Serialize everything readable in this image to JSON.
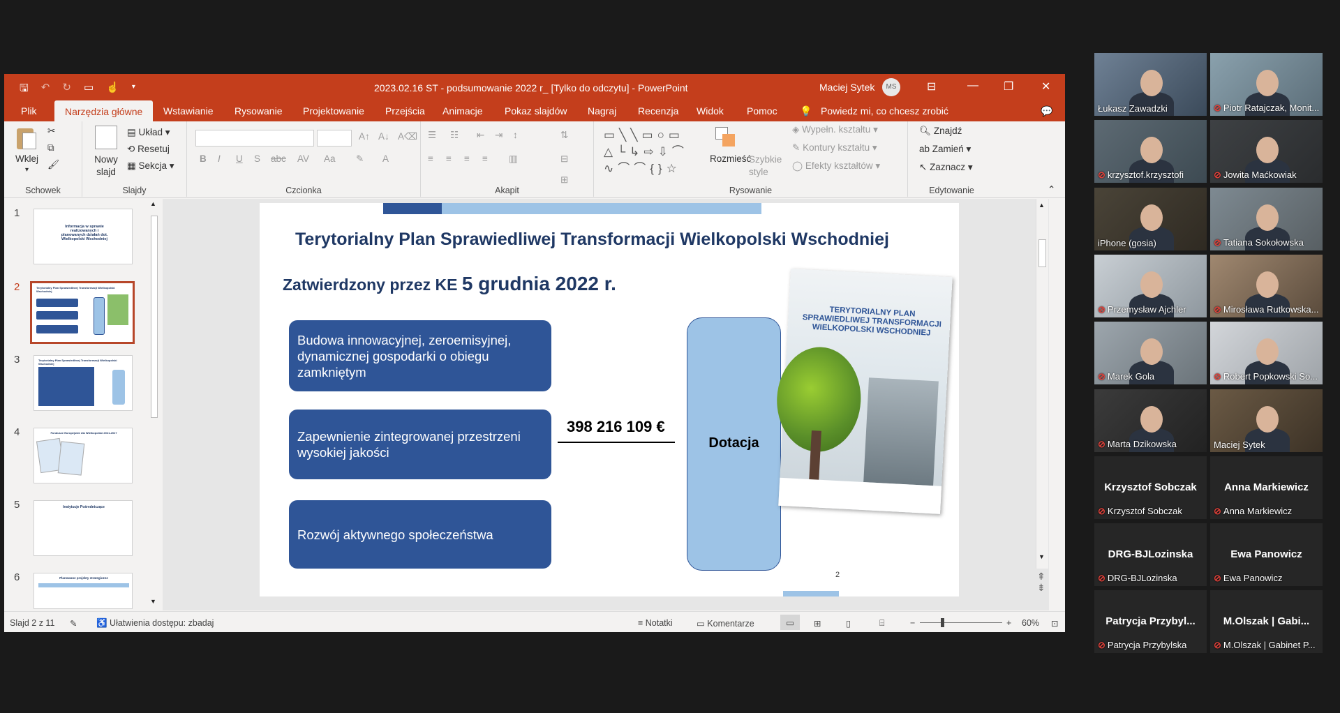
{
  "powerpoint": {
    "doc_title": "2023.02.16 ST - podsumowanie 2022 r_ [Tylko do odczytu]  -  PowerPoint",
    "user": "Maciej Sytek",
    "user_initials": "MS",
    "tabs": [
      "Plik",
      "Narzędzia główne",
      "Wstawianie",
      "Rysowanie",
      "Projektowanie",
      "Przejścia",
      "Animacje",
      "Pokaz slajdów",
      "Nagraj",
      "Recenzja",
      "Widok",
      "Pomoc"
    ],
    "active_tab": "Narzędzia główne",
    "tell_me": "Powiedz mi, co chcesz zrobić",
    "ribbon": {
      "schowek": {
        "label": "Schowek",
        "paste": "Wklej"
      },
      "slajdy": {
        "label": "Slajdy",
        "new_slide": "Nowy slajd",
        "layout": "Układ",
        "reset": "Resetuj",
        "section": "Sekcja"
      },
      "czcionka": {
        "label": "Czcionka"
      },
      "akapit": {
        "label": "Akapit"
      },
      "rysowanie": {
        "label": "Rysowanie",
        "arrange": "Rozmieść",
        "quick_styles": "Szybkie style",
        "fill": "Wypełn. kształtu",
        "outline": "Kontury kształtu",
        "effects": "Efekty kształtów"
      },
      "edytowanie": {
        "label": "Edytowanie",
        "find": "Znajdź",
        "replace": "Zamień",
        "select": "Zaznacz"
      }
    },
    "thumbnails": [
      {
        "num": "1",
        "title": "Informacja w sprawie realizowanych i planowanych działań dot. Wielkopolski Wschodniej"
      },
      {
        "num": "2",
        "title": "Terytorialny Plan Sprawiedliwej Transformacji Wielkopolski Wschodniej"
      },
      {
        "num": "3",
        "title": "Terytorialny Plan Sprawiedliwej Transformacji Wielkopolski Wschodniej"
      },
      {
        "num": "4",
        "title": "Fundusze Europejskie dla Wielkopolski 2021-2027"
      },
      {
        "num": "5",
        "title": "Instytucje Pośredniczące"
      },
      {
        "num": "6",
        "title": "Planowane projekty strategiczne"
      }
    ],
    "slide": {
      "title": "Terytorialny Plan Sprawiedliwej Transformacji Wielkopolski Wschodniej",
      "subtitle_prefix": "Zatwierdzony przez KE",
      "subtitle_date": "5 grudnia 2022 r.",
      "boxes": [
        "Budowa innowacyjnej, zeroemisyjnej, dynamicznej gospodarki o obiegu zamkniętym",
        "Zapewnienie zintegrowanej przestrzeni wysokiej jakości",
        "Rozwój aktywnego społeczeństwa"
      ],
      "amount": "398 216 109 €",
      "grant": "Dotacja",
      "cover_title": "TERYTORIALNY PLAN SPRAWIEDLIWEJ TRANSFORMACJI WIELKOPOLSKI WSCHODNIEJ",
      "page_number": "2"
    },
    "status": {
      "slide_info": "Slajd 2 z 11",
      "accessibility": "Ułatwienia dostępu: zbadaj",
      "notes": "Notatki",
      "comments": "Komentarze",
      "zoom": "60%"
    }
  },
  "participants": [
    {
      "name": "Łukasz Zawadzki",
      "muted": false,
      "video": true
    },
    {
      "name": "Piotr Ratajczak, Monit...",
      "muted": true,
      "video": true
    },
    {
      "name": "krzysztof.krzysztofi",
      "muted": true,
      "video": true
    },
    {
      "name": "Jowita Maćkowiak",
      "muted": true,
      "video": true
    },
    {
      "name": "iPhone (gosia)",
      "muted": false,
      "video": true
    },
    {
      "name": "Tatiana Sokołowska",
      "muted": true,
      "video": true
    },
    {
      "name": "Przemysław Ajchler",
      "muted": true,
      "video": true
    },
    {
      "name": "Mirosława Rutkowska...",
      "muted": true,
      "video": true
    },
    {
      "name": "Marek Gola",
      "muted": true,
      "video": true
    },
    {
      "name": "Robert Popkowski So...",
      "muted": true,
      "video": true
    },
    {
      "name": "Marta Dzikowska",
      "muted": true,
      "video": true
    },
    {
      "name": "Maciej Sytek",
      "muted": false,
      "video": true,
      "active": true
    },
    {
      "name": "Krzysztof Sobczak",
      "big": "Krzysztof Sobczak",
      "muted": true,
      "video": false
    },
    {
      "name": "Anna Markiewicz",
      "big": "Anna Markiewicz",
      "muted": true,
      "video": false
    },
    {
      "name": "DRG-BJLozinska",
      "big": "DRG-BJLozinska",
      "muted": true,
      "video": false
    },
    {
      "name": "Ewa Panowicz",
      "big": "Ewa Panowicz",
      "muted": true,
      "video": false
    },
    {
      "name": "Patrycja Przybylska",
      "big": "Patrycja  Przybyl...",
      "muted": true,
      "video": false
    },
    {
      "name": "M.Olszak | Gabinet P...",
      "big": "M.Olszak | Gabi...",
      "muted": true,
      "video": false
    }
  ],
  "colors": {
    "accent": "#c43e1c",
    "slide_blue": "#2f5597",
    "light_blue": "#9dc3e6",
    "active_speaker": "#c9e53a"
  }
}
